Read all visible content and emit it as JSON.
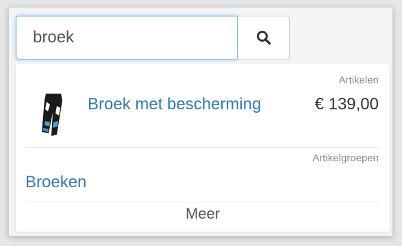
{
  "search": {
    "value": "broek",
    "button_icon": "search-icon"
  },
  "results": {
    "articles_heading": "Artikelen",
    "product": {
      "name": "Broek met bescherming",
      "price": "€ 139,00",
      "thumbnail_icon": "pants-thumbnail"
    },
    "groups_heading": "Artikelgroepen",
    "group": {
      "name": "Broeken"
    },
    "more_label": "Meer"
  },
  "colors": {
    "link": "#337ab7",
    "focus_border": "#66afe9",
    "muted_text": "#888888"
  }
}
